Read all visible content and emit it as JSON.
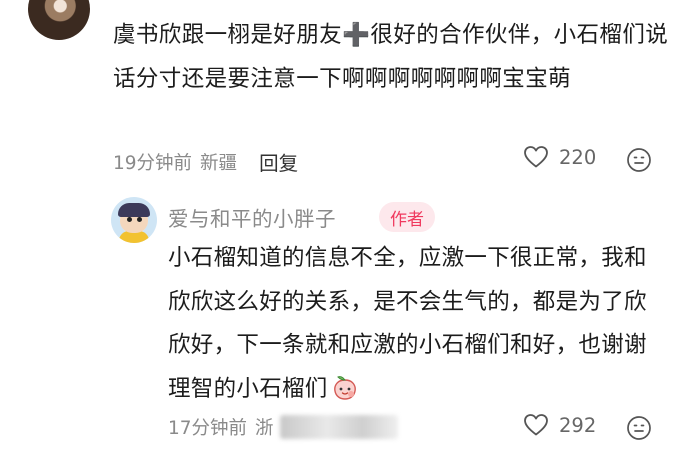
{
  "comment": {
    "text": "虞书欣跟一栩是好朋友➕很好的合作伙伴，小石榴们说话分寸还是要注意一下啊啊啊啊啊啊啊宝宝萌",
    "time": "19分钟前",
    "location": "新疆",
    "reply_label": "回复",
    "likes": "220"
  },
  "reply": {
    "username": "爱与和平的小胖子",
    "badge": "作者",
    "text": "小石榴知道的信息不全，应激一下很正常，我和欣欣这么好的关系，是不会生气的，都是为了欣欣好，下一条就和应激的小石榴们和好，也谢谢理智的小石榴们",
    "time": "17分钟前",
    "location": "浙",
    "likes": "292"
  },
  "icons": {
    "like": "heart-outline-icon",
    "emoji": "emoji-face-icon",
    "sticker": "peach-emoji-icon"
  },
  "colors": {
    "text": "#1c1c1c",
    "meta": "#8a8a8a",
    "author_badge_bg": "#fde8ec",
    "author_badge_text": "#f0395e"
  }
}
